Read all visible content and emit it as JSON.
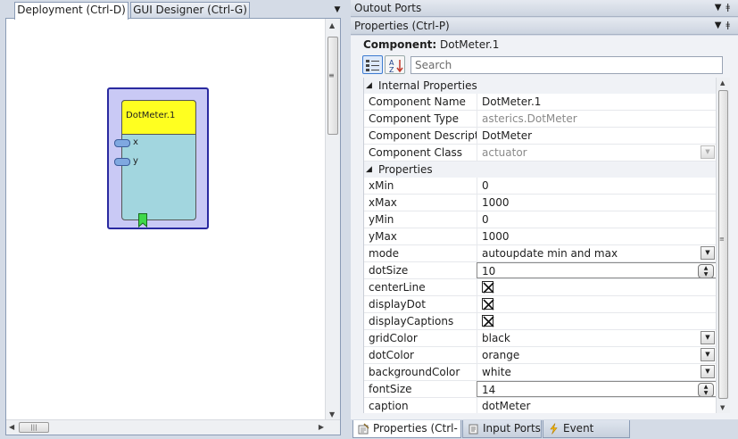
{
  "left": {
    "tabs": [
      {
        "label": "Deployment (Ctrl-D)",
        "active": true
      },
      {
        "label": "GUI Designer (Ctrl-G)",
        "active": false
      }
    ],
    "menu_icon": "dropdown-arrow-icon",
    "component": {
      "title": "DotMeter.1",
      "title_color": "#ffff20",
      "body_color": "#a2d6df",
      "frame_color": "#c9c9f5",
      "input_ports": [
        "x",
        "y"
      ],
      "event_icon": "event-trigger-icon"
    }
  },
  "right": {
    "outports_header": "Outout Ports",
    "props_header": "Properties (Ctrl-P)",
    "header_icons": [
      "dropdown-arrow-icon",
      "pin-icon"
    ],
    "component_label": "Component:",
    "component_value": "DotMeter.1",
    "search_placeholder": "Search",
    "categories": {
      "internal": "Internal Properties",
      "properties": "Properties"
    },
    "internal_rows": [
      {
        "name": "Component Name",
        "value": "DotMeter.1"
      },
      {
        "name": "Component Type",
        "value": "asterics.DotMeter"
      },
      {
        "name": "Component Descriptio",
        "value": "DotMeter"
      },
      {
        "name": "Component Class",
        "value": "actuator"
      }
    ],
    "property_rows": [
      {
        "name": "xMin",
        "value": "0"
      },
      {
        "name": "xMax",
        "value": "1000"
      },
      {
        "name": "yMin",
        "value": "0"
      },
      {
        "name": "yMax",
        "value": "1000"
      },
      {
        "name": "mode",
        "value": "autoupdate min and max"
      },
      {
        "name": "dotSize",
        "value": "10"
      },
      {
        "name": "centerLine",
        "checked": true
      },
      {
        "name": "displayDot",
        "checked": true
      },
      {
        "name": "displayCaptions",
        "checked": true
      },
      {
        "name": "gridColor",
        "value": "black"
      },
      {
        "name": "dotColor",
        "value": "orange"
      },
      {
        "name": "backgroundColor",
        "value": "white"
      },
      {
        "name": "fontSize",
        "value": "14"
      },
      {
        "name": "caption",
        "value": "dotMeter"
      }
    ],
    "bottom_tabs": [
      {
        "label": "Properties (Ctrl-P)",
        "icon": "properties-icon",
        "active": true
      },
      {
        "label": "Input Ports",
        "icon": "input-ports-icon",
        "active": false
      },
      {
        "label": "Event Listener",
        "icon": "lightning-icon",
        "active": false
      }
    ]
  }
}
